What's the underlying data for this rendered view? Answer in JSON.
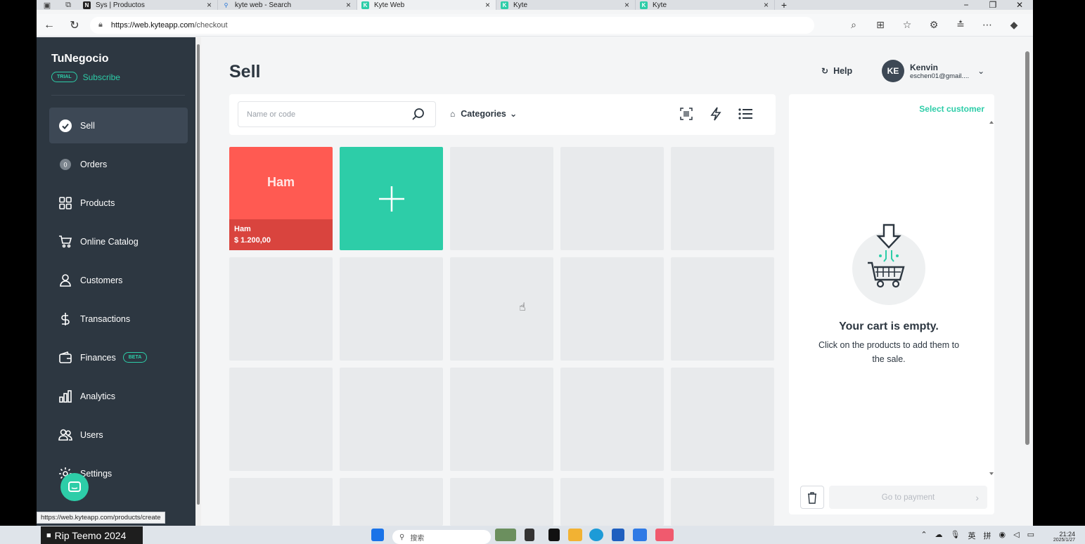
{
  "browser": {
    "tabs": [
      {
        "label": "Sys | Productos",
        "icon": "notion-icon"
      },
      {
        "label": "kyte web - Search",
        "icon": "search-icon"
      },
      {
        "label": "Kyte Web",
        "icon": "kyte-icon"
      },
      {
        "label": "Kyte",
        "icon": "kyte-icon"
      },
      {
        "label": "Kyte",
        "icon": "kyte-icon"
      }
    ],
    "url_host": "https://web.kyteapp.com",
    "url_path": "/checkout",
    "status_url": "https://web.kyteapp.com/products/create"
  },
  "sidebar": {
    "brand": "TuNegocio",
    "trial_badge": "TRIAL",
    "subscribe": "Subscribe",
    "items": [
      {
        "label": "Sell",
        "icon": "check-circle-icon"
      },
      {
        "label": "Orders",
        "icon": "orders-badge-icon",
        "badge": "0"
      },
      {
        "label": "Products",
        "icon": "grid-icon"
      },
      {
        "label": "Online Catalog",
        "icon": "cart-icon"
      },
      {
        "label": "Customers",
        "icon": "person-icon"
      },
      {
        "label": "Transactions",
        "icon": "dollar-icon"
      },
      {
        "label": "Finances",
        "icon": "wallet-icon",
        "badge": "BETA"
      },
      {
        "label": "Analytics",
        "icon": "bar-chart-icon"
      },
      {
        "label": "Users",
        "icon": "users-icon"
      },
      {
        "label": "Settings",
        "icon": "gear-icon"
      }
    ]
  },
  "header": {
    "title": "Sell",
    "help": "Help",
    "user": {
      "initials": "KE",
      "name": "Kenvin",
      "email": "eschen01@gmail...."
    }
  },
  "search": {
    "placeholder": "Name or code",
    "categories": "Categories"
  },
  "products": [
    {
      "name": "Ham",
      "label": "Ham",
      "price": "$ 1.200,00",
      "color": "#ff5a52"
    }
  ],
  "cart": {
    "select_customer": "Select customer",
    "empty_title": "Your cart is empty.",
    "empty_desc": "Click on the products to add them to the sale.",
    "pay_button": "Go to payment"
  },
  "taskbar": {
    "live_badge": "Rip Teemo 2024",
    "search_placeholder": "搜索",
    "tray_lang1": "英",
    "tray_lang2": "拼",
    "clock_time": "21:24",
    "clock_date": "2025/1/27"
  },
  "colors": {
    "accent": "#2dcda8",
    "sidebar": "#2d3741",
    "product_red": "#ff5a52"
  }
}
